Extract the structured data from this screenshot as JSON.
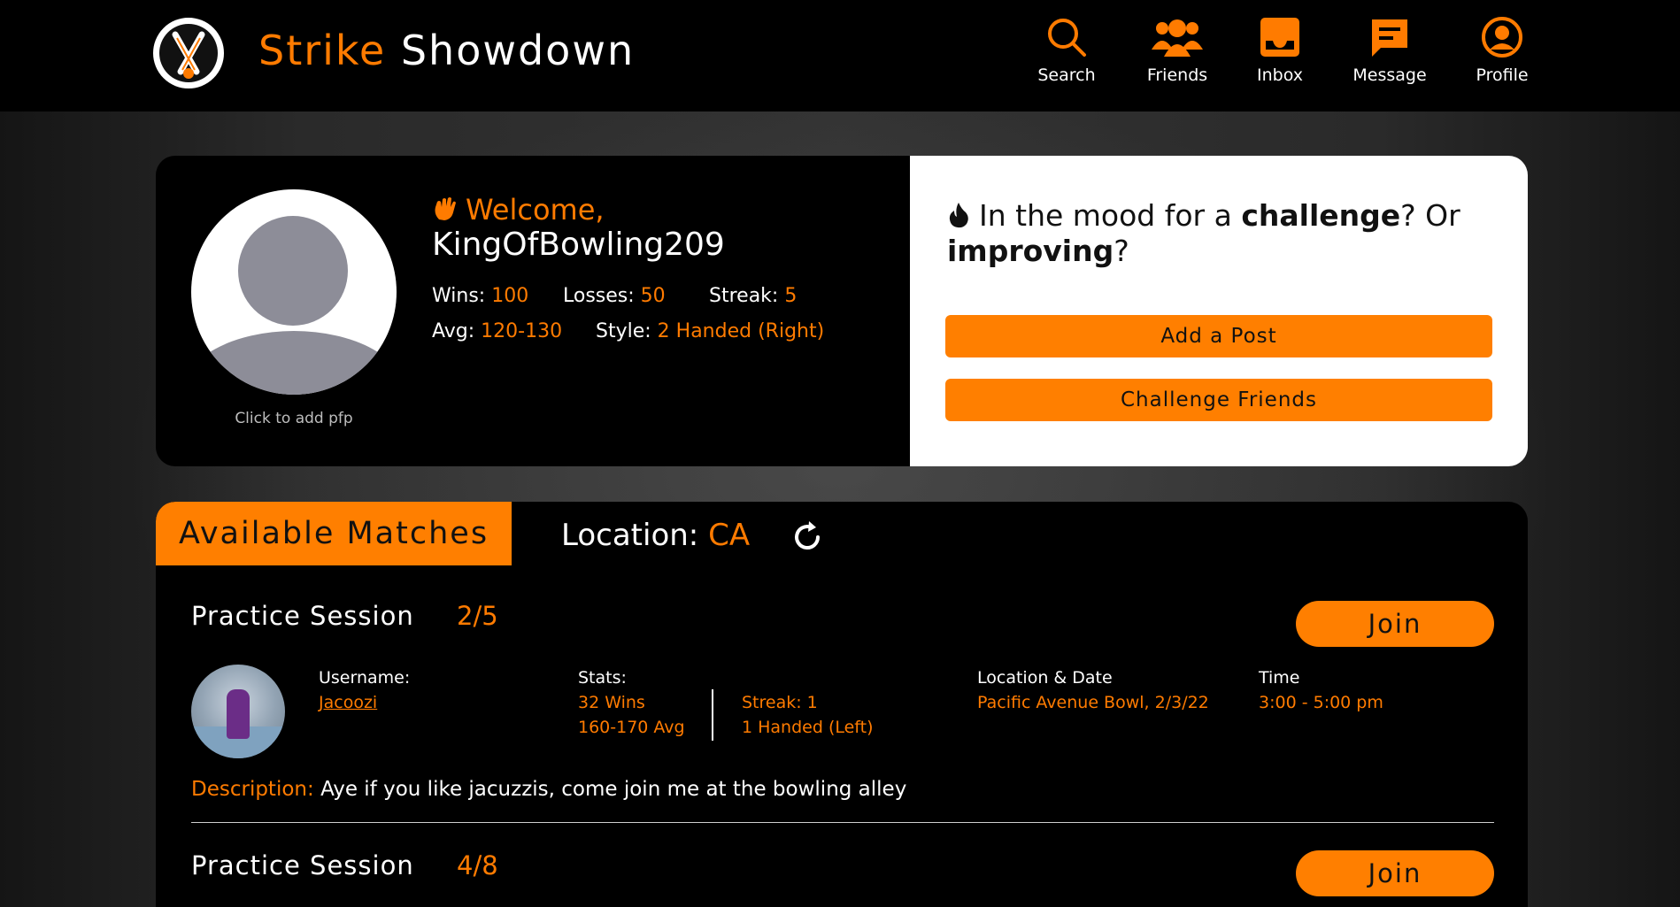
{
  "app": {
    "brand_part1": "Strike",
    "brand_part2": "Showdown",
    "accent": "#ff7f00"
  },
  "nav": [
    {
      "label": "Search",
      "icon": "search-icon"
    },
    {
      "label": "Friends",
      "icon": "friends-icon"
    },
    {
      "label": "Inbox",
      "icon": "inbox-icon"
    },
    {
      "label": "Message",
      "icon": "message-icon"
    },
    {
      "label": "Profile",
      "icon": "profile-icon"
    }
  ],
  "profile": {
    "welcome": "Welcome,",
    "username": "KingOfBowling209",
    "pfp_hint": "Click to add pfp",
    "wins_label": "Wins:",
    "wins": "100",
    "losses_label": "Losses:",
    "losses": "50",
    "streak_label": "Streak:",
    "streak": "5",
    "avg_label": "Avg:",
    "avg": "120-130",
    "style_label": "Style:",
    "style": "2 Handed (Right)"
  },
  "challenge": {
    "text_1": "In the mood for a",
    "word_1": "challenge",
    "text_2": "? Or",
    "word_2": "improving",
    "text_3": "?",
    "add_post": "Add a Post",
    "challenge_friends": "Challenge Friends"
  },
  "matches": {
    "tab_label": "Available Matches",
    "location_label": "Location:",
    "location_value": "CA",
    "items": [
      {
        "title": "Practice Session",
        "count": "2/5",
        "join": "Join",
        "username_label": "Username:",
        "username": "Jacoozi",
        "stats_label": "Stats:",
        "wins": "32 Wins",
        "avg": "160-170 Avg",
        "streak": "Streak: 1",
        "style": "1 Handed (Left)",
        "loc_date_label": "Location & Date",
        "loc_date": "Pacific Avenue Bowl, 2/3/22",
        "time_label": "Time",
        "time": "3:00 - 5:00 pm",
        "desc_label": "Description:",
        "desc": "Aye if you like jacuzzis, come join me at the bowling alley"
      },
      {
        "title": "Practice Session",
        "count": "4/8",
        "join": "Join"
      }
    ]
  }
}
